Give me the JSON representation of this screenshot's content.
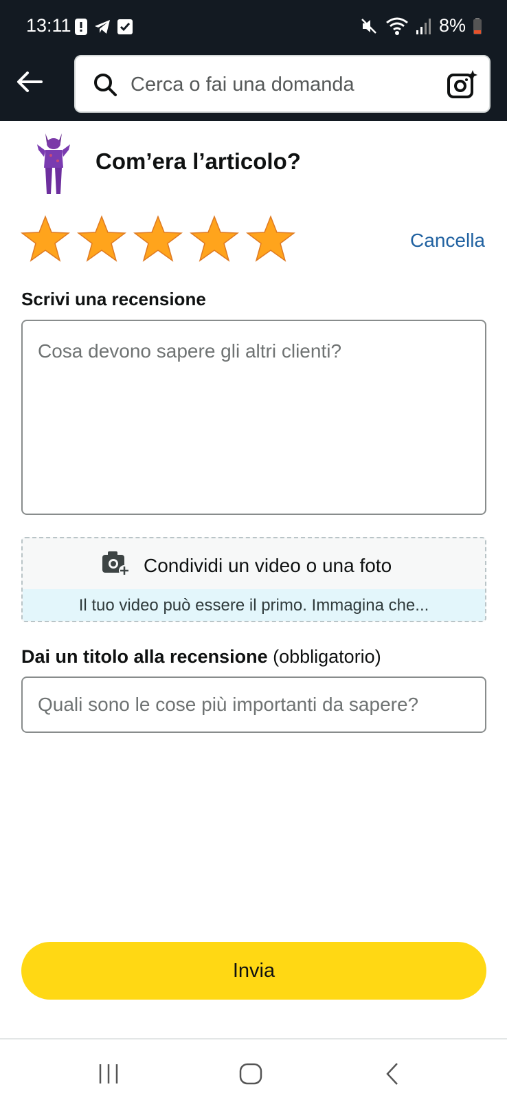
{
  "status_bar": {
    "time": "13:11",
    "battery": "8%",
    "icons": [
      "alert-icon",
      "telegram-icon",
      "checkbox-icon",
      "mute-icon",
      "wifi-icon",
      "signal-icon",
      "battery-icon"
    ]
  },
  "header": {
    "search_placeholder": "Cerca o fai una domanda",
    "icons": [
      "back-arrow-icon",
      "search-icon",
      "camera-search-icon"
    ]
  },
  "review": {
    "heading": "Com’era l’articolo?",
    "rating": 5,
    "rating_max": 5,
    "clear_label": "Cancella",
    "write_label": "Scrivi una recensione",
    "write_placeholder": "Cosa devono sapere gli altri clienti?",
    "media_label": "Condividi un video o una foto",
    "media_hint": "Il tuo video può essere il primo. Immagina che...",
    "title_label": "Dai un titolo alla recensione",
    "title_required": "(obbligatorio)",
    "title_placeholder": "Quali sono le cose più importanti da sapere?",
    "submit_label": "Invia"
  },
  "colors": {
    "header_bg": "#131a22",
    "star": "#ffa41c",
    "link": "#2162a1",
    "submit_bg": "#ffd814",
    "hint_bg": "#e3f6fb"
  },
  "nav_bar": {
    "icons": [
      "recent-apps-icon",
      "home-icon",
      "back-icon"
    ]
  }
}
